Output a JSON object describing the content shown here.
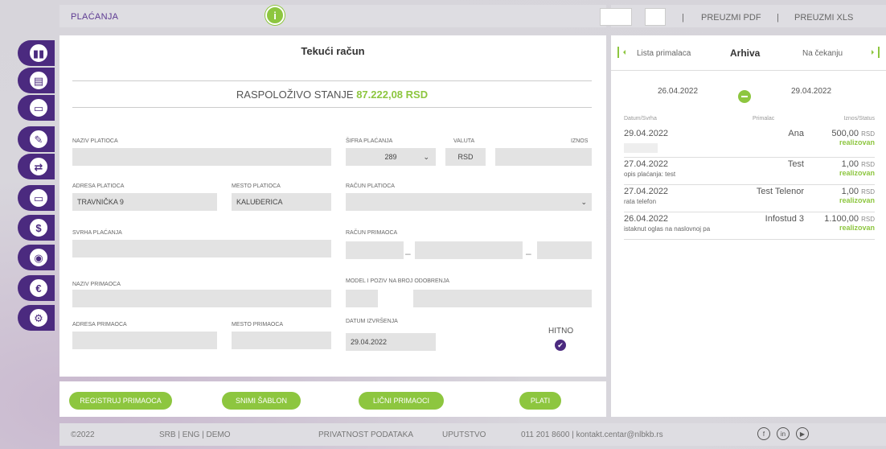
{
  "header": {
    "title": "PLAĆANJA",
    "info_icon": "info-icon",
    "download_pdf": "PREUZMI PDF",
    "download_xls": "PREUZMI XLS",
    "separator": "|"
  },
  "sidebar": {
    "items": [
      {
        "name": "accounts-icon",
        "glyph": "▮▮"
      },
      {
        "name": "statements-icon",
        "glyph": "▤"
      },
      {
        "name": "cards-icon",
        "glyph": "▭"
      },
      {
        "name": "payments-icon",
        "glyph": "✎"
      },
      {
        "name": "exchange-icon",
        "glyph": "⇄"
      },
      {
        "name": "loans-icon",
        "glyph": "▭"
      },
      {
        "name": "savings-icon",
        "glyph": "$"
      },
      {
        "name": "location-icon",
        "glyph": "◉"
      },
      {
        "name": "currency-icon",
        "glyph": "€"
      },
      {
        "name": "settings-icon",
        "glyph": "⚙"
      }
    ]
  },
  "form": {
    "title": "Tekući račun",
    "balance_label": "RASPOLOŽIVO STANJE",
    "balance_value": "87.222,08 RSD",
    "payer_name_label": "NAZIV PLATIOCA",
    "payer_name_value": "",
    "payment_code_label": "ŠIFRA PLAĆANJA",
    "payment_code_value": "289",
    "currency_label": "VALUTA",
    "currency_value": "RSD",
    "amount_label": "IZNOS",
    "amount_value": "",
    "payer_address_label": "ADRESA PLATIOCA",
    "payer_address_value": "TRAVNIČKA 9",
    "payer_city_label": "MESTO PLATIOCA",
    "payer_city_value": "KALUĐERICA",
    "payer_account_label": "RAČUN PLATIOCA",
    "payment_purpose_label": "SVRHA PLAĆANJA",
    "recipient_account_label": "RAČUN PRIMAOCA",
    "recipient_name_label": "NAZIV PRIMAOCA",
    "model_label": "MODEL I POZIV NA BROJ ODOBRENJA",
    "recipient_address_label": "ADRESA PRIMAOCA",
    "recipient_city_label": "MESTO PRIMAOCA",
    "execution_date_label": "DATUM IZVRŠENJA",
    "execution_date_value": "29.04.2022",
    "urgent_label": "HITNO",
    "dash": "–"
  },
  "buttons": {
    "register": "REGISTRUJ PRIMAOCA",
    "save_template": "SNIMI ŠABLON",
    "personal": "LIČNI PRIMAOCI",
    "pay": "PLATI"
  },
  "archive": {
    "tab_recipients": "Lista primalaca",
    "tab_archive": "Arhiva",
    "tab_pending": "Na čekanju",
    "date_from": "26.04.2022",
    "date_to": "29.04.2022",
    "col_date": "Datum/Svrha",
    "col_recipient": "Primalac",
    "col_amount": "Iznos/Status",
    "rows": [
      {
        "date": "29.04.2022",
        "purpose": "",
        "recipient": "Ana",
        "amount": "500,00",
        "currency": "RSD",
        "status": "realizovan"
      },
      {
        "date": "27.04.2022",
        "purpose": "opis plaćanja: test",
        "recipient": "Test",
        "amount": "1,00",
        "currency": "RSD",
        "status": "realizovan"
      },
      {
        "date": "27.04.2022",
        "purpose": "rata telefon",
        "recipient": "Test Telenor",
        "amount": "1,00",
        "currency": "RSD",
        "status": "realizovan"
      },
      {
        "date": "26.04.2022",
        "purpose": "istaknut oglas na naslovnoj pa",
        "recipient": "Infostud 3",
        "amount": "1.100,00",
        "currency": "RSD",
        "status": "realizovan"
      }
    ]
  },
  "footer": {
    "copyright": "©2022",
    "langs": "SRB | ENG | DEMO",
    "privacy": "PRIVATNOST PODATAKA",
    "guide": "UPUTSTVO",
    "contact": "011 201 8600 | kontakt.centar@nlbkb.rs",
    "social": [
      "facebook-icon",
      "linkedin-icon",
      "youtube-icon"
    ]
  }
}
